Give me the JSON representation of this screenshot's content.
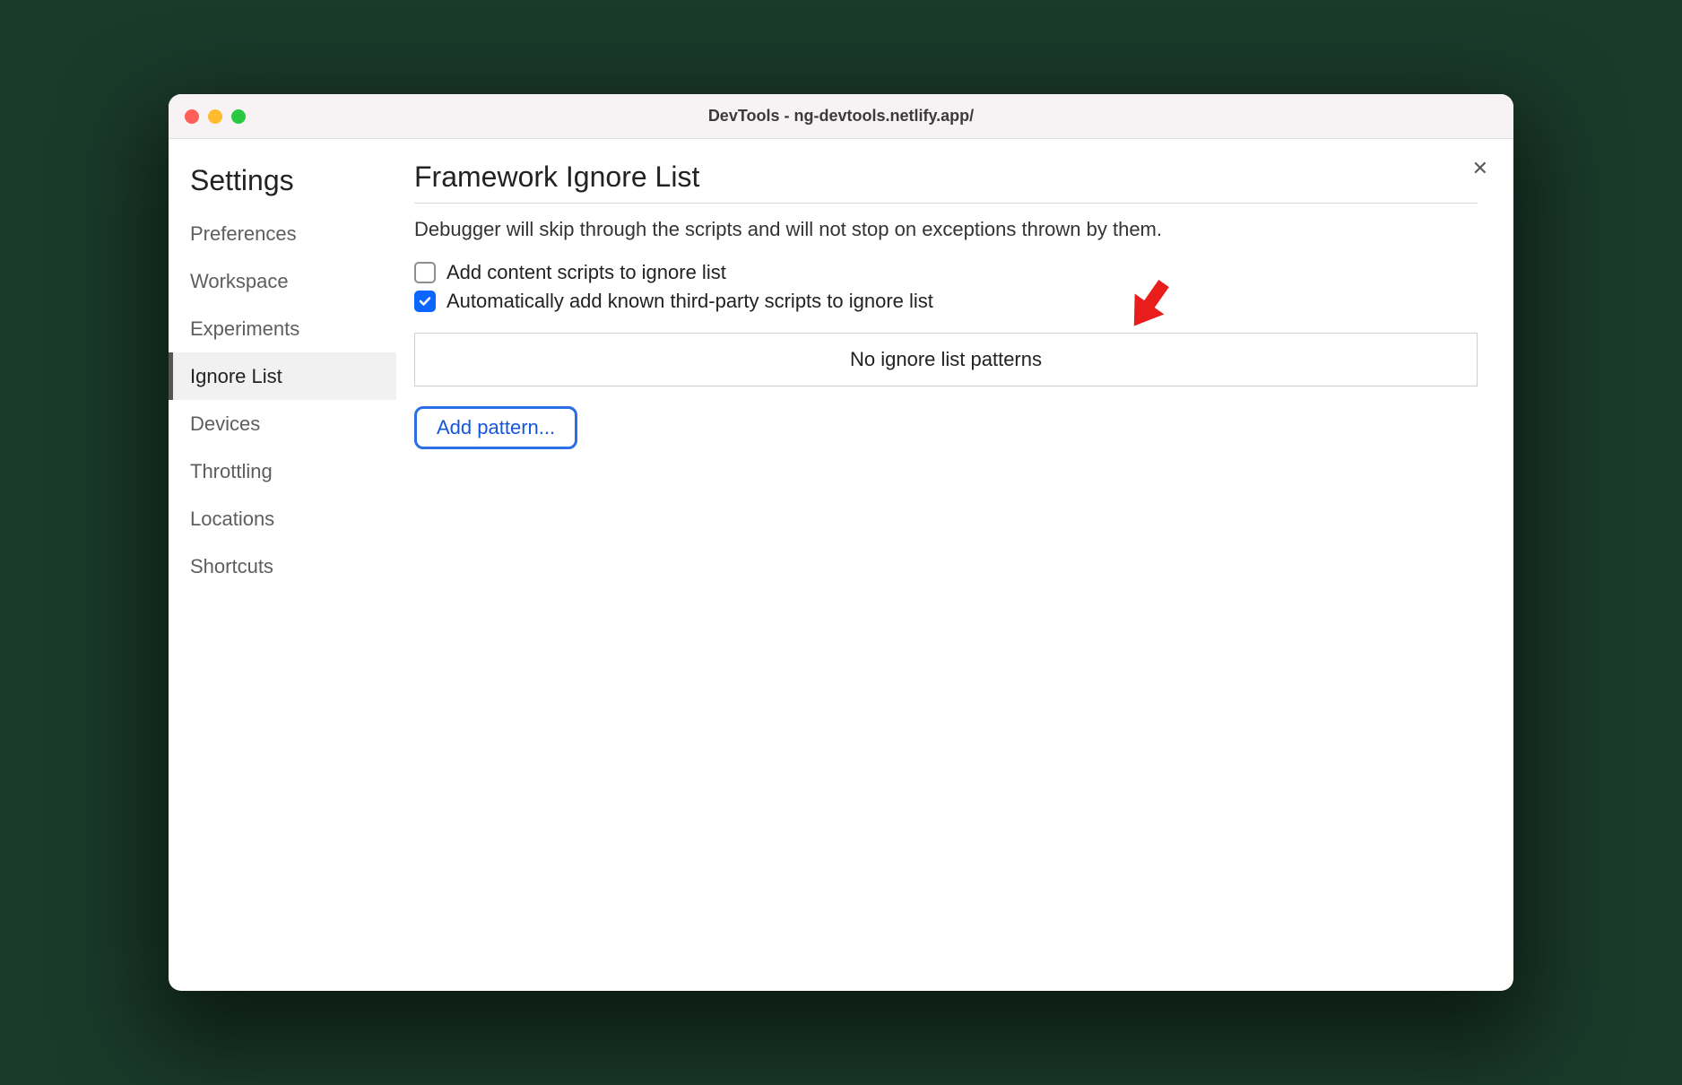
{
  "window": {
    "title": "DevTools - ng-devtools.netlify.app/"
  },
  "sidebar": {
    "heading": "Settings",
    "items": [
      {
        "label": "Preferences",
        "active": false
      },
      {
        "label": "Workspace",
        "active": false
      },
      {
        "label": "Experiments",
        "active": false
      },
      {
        "label": "Ignore List",
        "active": true
      },
      {
        "label": "Devices",
        "active": false
      },
      {
        "label": "Throttling",
        "active": false
      },
      {
        "label": "Locations",
        "active": false
      },
      {
        "label": "Shortcuts",
        "active": false
      }
    ]
  },
  "main": {
    "heading": "Framework Ignore List",
    "description": "Debugger will skip through the scripts and will not stop on exceptions thrown by them.",
    "checkbox1": {
      "label": "Add content scripts to ignore list",
      "checked": false
    },
    "checkbox2": {
      "label": "Automatically add known third-party scripts to ignore list",
      "checked": true
    },
    "patterns_empty": "No ignore list patterns",
    "add_pattern_label": "Add pattern..."
  },
  "close_label": "✕"
}
